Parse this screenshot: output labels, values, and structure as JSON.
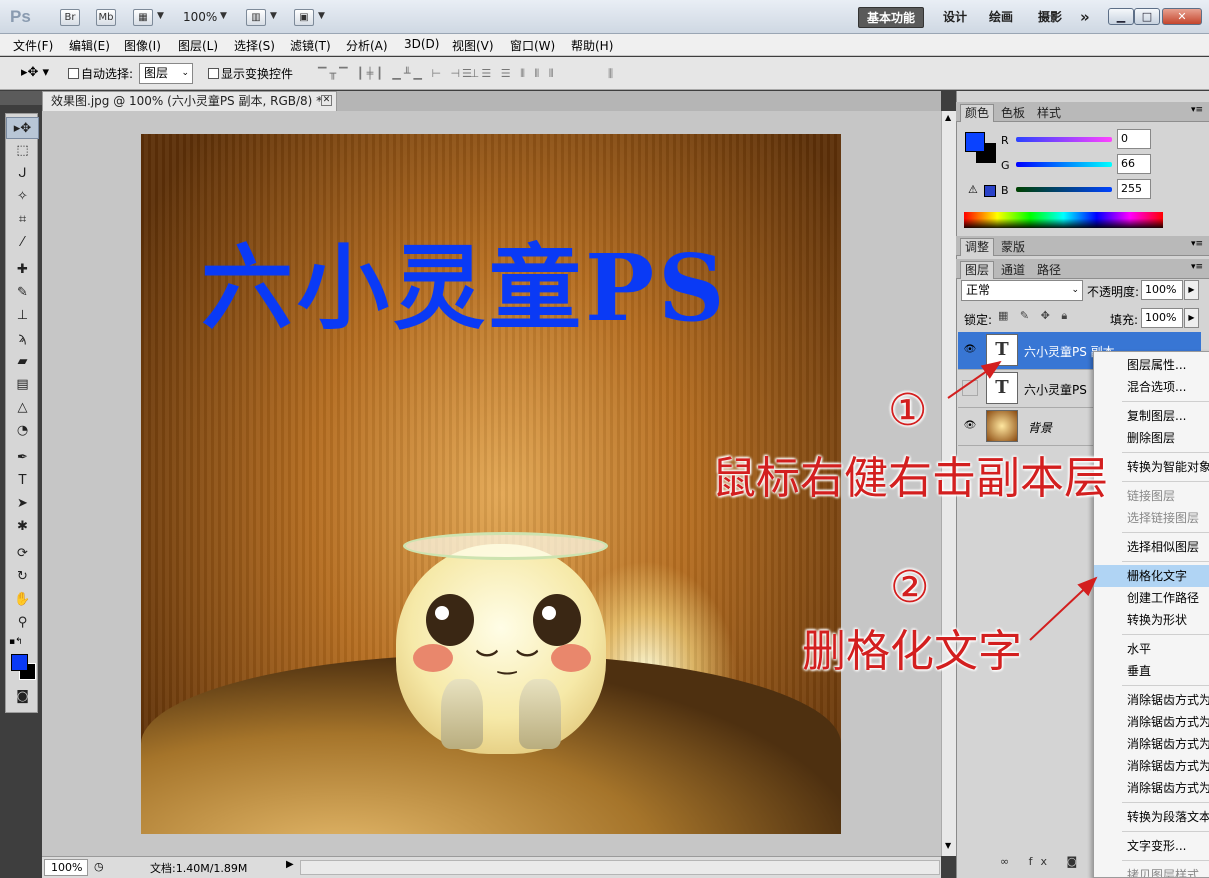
{
  "titlebar": {
    "logo": "Ps",
    "btn_br": "Br",
    "btn_mb": "Mb",
    "zoom": "100%",
    "workspaces": [
      "基本功能",
      "设计",
      "绘画",
      "摄影"
    ],
    "more": "»"
  },
  "menubar": [
    "文件(F)",
    "编辑(E)",
    "图像(I)",
    "图层(L)",
    "选择(S)",
    "滤镜(T)",
    "分析(A)",
    "3D(D)",
    "视图(V)",
    "窗口(W)",
    "帮助(H)"
  ],
  "options": {
    "auto_select_label": "自动选择:",
    "auto_select_value": "图层",
    "show_transform": "显示变换控件"
  },
  "document": {
    "tab_title": "效果图.jpg @ 100% (六小灵童PS 副本, RGB/8) *",
    "canvas_text": "六小灵童PS",
    "zoom": "100%",
    "doc_info": "文档:1.40M/1.89M"
  },
  "color_panel": {
    "tabs": [
      "颜色",
      "色板",
      "样式"
    ],
    "r": "0",
    "g": "66",
    "b": "255",
    "fg_color": "#0042ff"
  },
  "adjust_tabs": [
    "调整",
    "蒙版"
  ],
  "layers_panel": {
    "tabs": [
      "图层",
      "通道",
      "路径"
    ],
    "blend_mode": "正常",
    "opacity_label": "不透明度:",
    "opacity": "100%",
    "lock_label": "锁定:",
    "fill_label": "填充:",
    "fill": "100%",
    "layers": [
      {
        "name": "六小灵童PS 副本",
        "selected": true
      },
      {
        "name": "六小灵童PS",
        "selected": false
      },
      {
        "name": "背景",
        "selected": false
      }
    ]
  },
  "context_menu": [
    {
      "label": "图层属性..."
    },
    {
      "label": "混合选项..."
    },
    {
      "sep": true
    },
    {
      "label": "复制图层..."
    },
    {
      "label": "删除图层"
    },
    {
      "sep": true
    },
    {
      "label": "转换为智能对象"
    },
    {
      "sep": true
    },
    {
      "label": "链接图层",
      "disabled": true
    },
    {
      "label": "选择链接图层",
      "disabled": true
    },
    {
      "sep": true
    },
    {
      "label": "选择相似图层"
    },
    {
      "sep": true
    },
    {
      "label": "栅格化文字",
      "highlight": true
    },
    {
      "label": "创建工作路径"
    },
    {
      "label": "转换为形状"
    },
    {
      "sep": true
    },
    {
      "label": "水平"
    },
    {
      "label": "垂直"
    },
    {
      "sep": true
    },
    {
      "label": "消除锯齿方式为"
    },
    {
      "label": "消除锯齿方式为"
    },
    {
      "label": "消除锯齿方式为"
    },
    {
      "label": "消除锯齿方式为"
    },
    {
      "label": "消除锯齿方式为"
    },
    {
      "sep": true
    },
    {
      "label": "转换为段落文本"
    },
    {
      "sep": true
    },
    {
      "label": "文字变形..."
    },
    {
      "sep": true
    },
    {
      "label": "拷贝图层样式",
      "disabled": true
    }
  ],
  "annotations": {
    "step1_num": "①",
    "step1_text": "鼠标右健右击副本层",
    "step2_num": "②",
    "step2_text": "删格化文字"
  }
}
